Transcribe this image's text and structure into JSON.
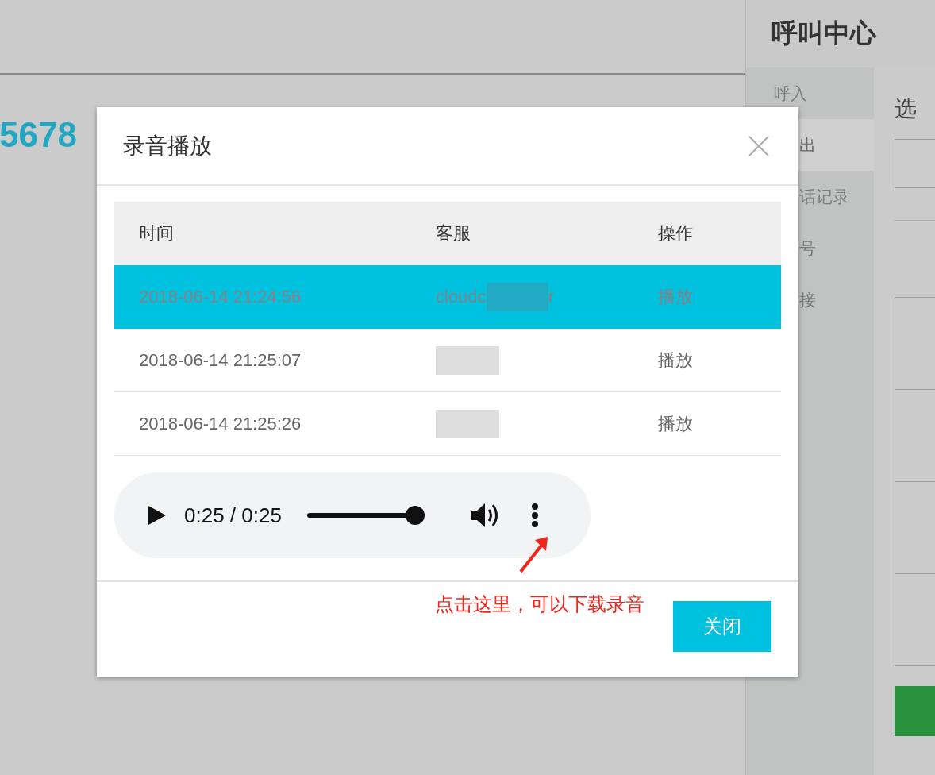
{
  "page": {
    "number_text": "5678"
  },
  "right_panel": {
    "title": "呼叫中心",
    "sidebar_items": [
      {
        "label": "呼入",
        "kind": "full",
        "selected": false
      },
      {
        "label": "出",
        "kind": "partial",
        "selected": true
      },
      {
        "label": "话记录",
        "kind": "partial",
        "selected": false
      },
      {
        "label": "号",
        "kind": "partial",
        "selected": false
      },
      {
        "label": "接",
        "kind": "partial",
        "selected": false
      }
    ],
    "content_heading": "选"
  },
  "dialog": {
    "title": "录音播放",
    "table": {
      "columns": [
        "时间",
        "客服",
        "操作"
      ],
      "rows": [
        {
          "time": "2018-06-14 21:24:56",
          "agent_parts": [
            "cloudc",
            "r"
          ],
          "redacted": true,
          "action": "播放",
          "selected": true
        },
        {
          "time": "2018-06-14 21:25:07",
          "redacted": true,
          "action": "播放",
          "selected": false
        },
        {
          "time": "2018-06-14 21:25:26",
          "redacted": true,
          "action": "播放",
          "selected": false
        }
      ]
    },
    "player": {
      "time": "0:25 / 0:25",
      "level": 1
    },
    "annotation": "点击这里，可以下载录音",
    "buttons": [
      "关闭"
    ]
  }
}
